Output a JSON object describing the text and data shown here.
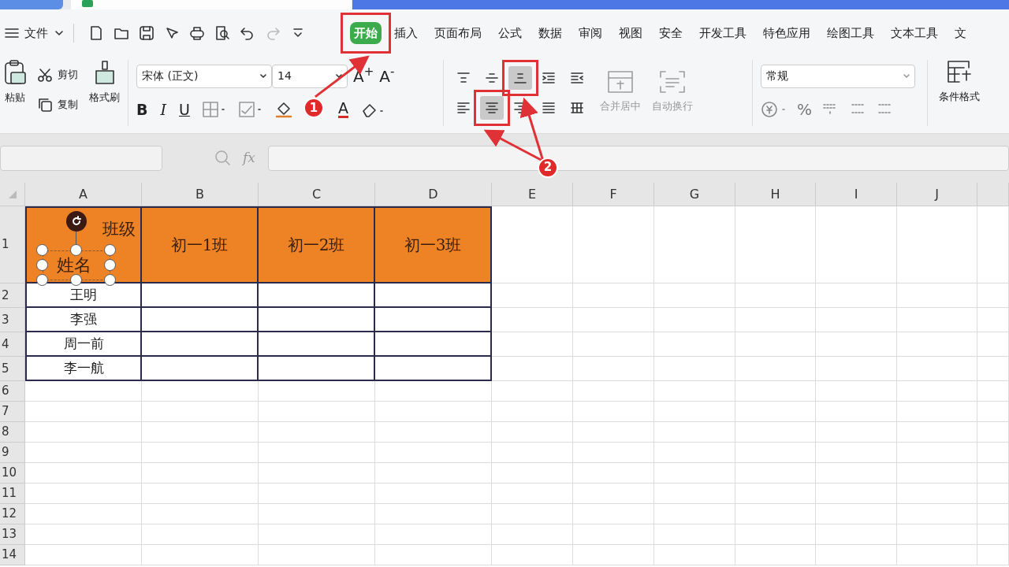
{
  "menu": {
    "file_label": "文件"
  },
  "ribbon_tabs": [
    {
      "label": "开始",
      "selected": true
    },
    {
      "label": "插入",
      "selected": false
    },
    {
      "label": "页面布局",
      "selected": false
    },
    {
      "label": "公式",
      "selected": false
    },
    {
      "label": "数据",
      "selected": false
    },
    {
      "label": "审阅",
      "selected": false
    },
    {
      "label": "视图",
      "selected": false
    },
    {
      "label": "安全",
      "selected": false
    },
    {
      "label": "开发工具",
      "selected": false
    },
    {
      "label": "特色应用",
      "selected": false
    },
    {
      "label": "绘图工具",
      "selected": false
    },
    {
      "label": "文本工具",
      "selected": false
    },
    {
      "label": "文",
      "selected": false
    }
  ],
  "clipboard": {
    "paste": "粘贴",
    "cut": "剪切",
    "copy": "复制",
    "format_painter": "格式刷"
  },
  "font": {
    "font_name": "宋体 (正文)",
    "font_size": "14",
    "grow": "A$^{+}$",
    "shrink": "A$^{-}$",
    "bold": "B",
    "italic": "I",
    "underline": "U",
    "font_color": "A"
  },
  "alignment": {
    "buttons": [
      {
        "kind": "top",
        "selected": false
      },
      {
        "kind": "middle",
        "selected": false
      },
      {
        "kind": "bottom",
        "selected": true
      },
      {
        "kind": "outdent",
        "selected": false
      },
      {
        "kind": "indent",
        "selected": false
      },
      {
        "kind": "left",
        "selected": false
      },
      {
        "kind": "center",
        "selected": true
      },
      {
        "kind": "right",
        "selected": false
      },
      {
        "kind": "justify",
        "selected": false
      },
      {
        "kind": "distribute",
        "selected": false
      }
    ],
    "merge": {
      "label": "合并居中",
      "disabled": true
    },
    "wrap": {
      "label": "自动换行",
      "disabled": true
    }
  },
  "number": {
    "format": "常规",
    "percent": "%"
  },
  "conditional_format": "条件格式",
  "formula_bar": {
    "fx": "fx"
  },
  "sheet": {
    "columns": [
      "A",
      "B",
      "C",
      "D",
      "E",
      "F",
      "G",
      "H",
      "I",
      "J"
    ],
    "rows": [
      {
        "header": "1",
        "kind": "header",
        "cells": [
          {
            "top": "班级",
            "bottom": "姓名"
          },
          "初一1班",
          "初一2班",
          "初一3班"
        ]
      },
      {
        "header": "2",
        "kind": "data",
        "cells": [
          "王明",
          "",
          "",
          ""
        ]
      },
      {
        "header": "3",
        "kind": "data",
        "cells": [
          "李强",
          "",
          "",
          ""
        ]
      },
      {
        "header": "4",
        "kind": "data",
        "cells": [
          "周一前",
          "",
          "",
          ""
        ]
      },
      {
        "header": "5",
        "kind": "data",
        "cells": [
          "李一航",
          "",
          "",
          ""
        ]
      },
      {
        "header": "6",
        "kind": "empty",
        "cells": []
      },
      {
        "header": "7",
        "kind": "empty",
        "cells": []
      },
      {
        "header": "8",
        "kind": "empty",
        "cells": []
      },
      {
        "header": "9",
        "kind": "empty",
        "cells": []
      },
      {
        "header": "10",
        "kind": "empty",
        "cells": []
      },
      {
        "header": "11",
        "kind": "empty",
        "cells": []
      },
      {
        "header": "12",
        "kind": "empty",
        "cells": []
      },
      {
        "header": "13",
        "kind": "empty",
        "cells": []
      },
      {
        "header": "14",
        "kind": "empty",
        "cells": []
      }
    ]
  },
  "annotations": [
    {
      "label": "1"
    },
    {
      "label": "2"
    }
  ]
}
